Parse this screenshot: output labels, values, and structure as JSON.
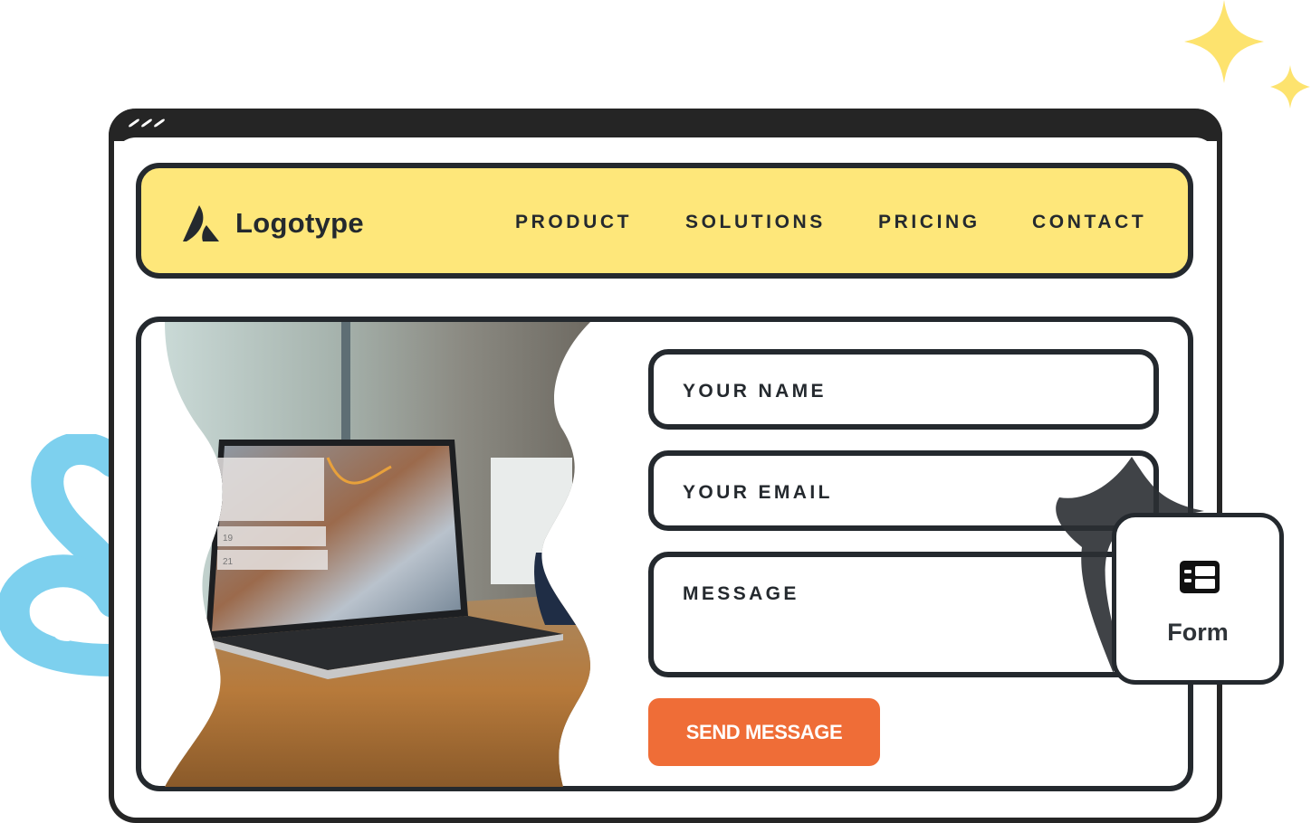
{
  "window": {
    "controls": [
      "dot",
      "dot",
      "dot"
    ]
  },
  "navbar": {
    "logo_text": "Logotype",
    "logo_icon": "logo-mark-icon",
    "items": [
      {
        "label": "PRODUCT"
      },
      {
        "label": "SOLUTIONS"
      },
      {
        "label": "PRICING"
      },
      {
        "label": "CONTACT"
      }
    ]
  },
  "hero_image": {
    "alt": "Laptop on wooden table with coffee mug",
    "screen_dates": [
      "19",
      "21"
    ]
  },
  "form": {
    "fields": [
      {
        "placeholder": "YOUR NAME",
        "value": ""
      },
      {
        "placeholder": "YOUR EMAIL",
        "value": ""
      },
      {
        "placeholder": "MESSAGE",
        "value": ""
      }
    ],
    "submit_label": "SEND MESSAGE"
  },
  "badge": {
    "label": "Form",
    "icon": "form-layout-icon"
  },
  "colors": {
    "outline": "#24292e",
    "navbar_bg": "#fee77a",
    "accent": "#ef6d37",
    "sparkle": "#fde36e",
    "squiggle": "#7dd0ee",
    "titlebar": "#252525"
  }
}
